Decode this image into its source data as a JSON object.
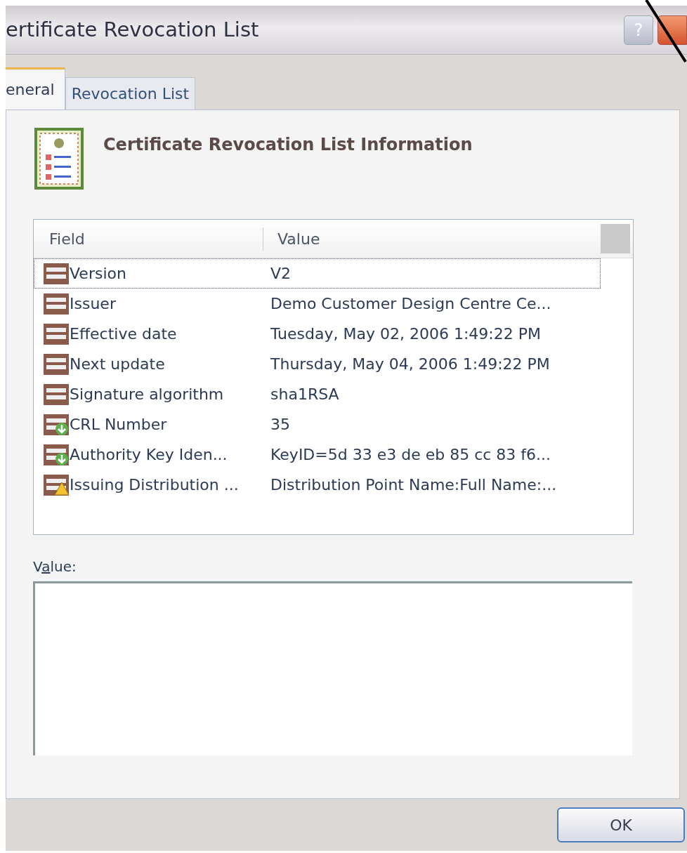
{
  "window": {
    "title": "ertificate Revocation List",
    "help_button": "?"
  },
  "tabs": [
    {
      "label": "eneral",
      "selected": true
    },
    {
      "label": "Revocation List",
      "selected": false
    }
  ],
  "heading": "Certificate Revocation List Information",
  "table": {
    "columns": [
      "Field",
      "Value"
    ],
    "rows": [
      {
        "kind": "property",
        "field": "Version",
        "value": "V2",
        "selected": true
      },
      {
        "kind": "property",
        "field": "Issuer",
        "value": "Demo Customer Design Centre Ce...",
        "selected": false
      },
      {
        "kind": "property",
        "field": "Effective date",
        "value": "Tuesday, May 02, 2006 1:49:22 PM",
        "selected": false
      },
      {
        "kind": "property",
        "field": "Next update",
        "value": "Thursday, May 04, 2006 1:49:22 PM",
        "selected": false
      },
      {
        "kind": "property",
        "field": "Signature algorithm",
        "value": "sha1RSA",
        "selected": false
      },
      {
        "kind": "extension",
        "field": "CRL Number",
        "value": "35",
        "selected": false
      },
      {
        "kind": "extension",
        "field": "Authority Key Iden...",
        "value": "KeyID=5d 33 e3 de eb 85 cc 83 f6...",
        "selected": false
      },
      {
        "kind": "critical",
        "field": "Issuing Distribution ...",
        "value": "Distribution Point Name:Full Name:...",
        "selected": false
      }
    ]
  },
  "value_label": {
    "before_key": "V",
    "access_key": "a",
    "after_key": "lue:"
  },
  "buttons": [
    "OK"
  ]
}
